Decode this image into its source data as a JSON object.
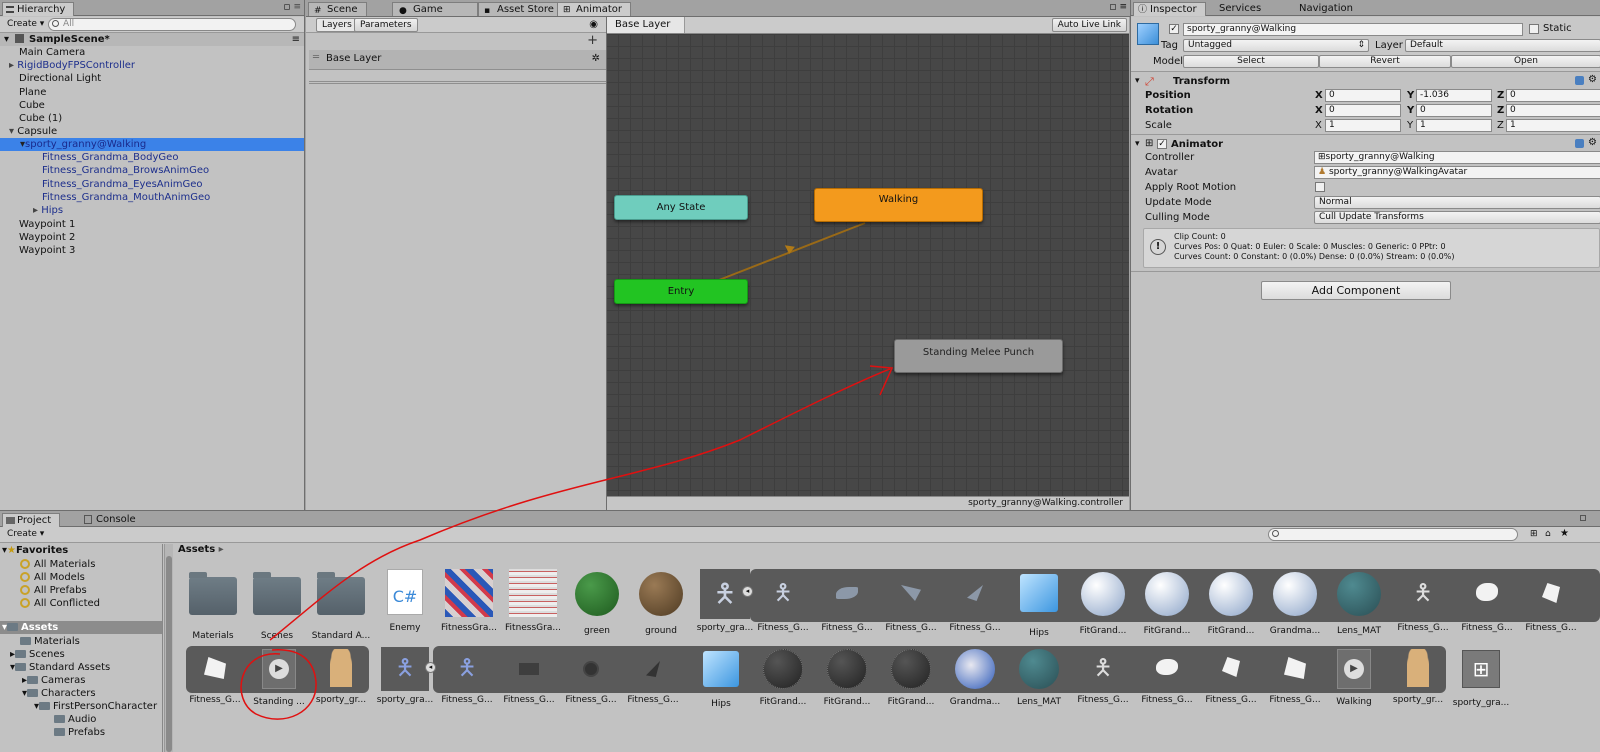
{
  "hierarchy": {
    "tab": "Hierarchy",
    "create": "Create",
    "search_placeholder": "All",
    "scene": "SampleScene*",
    "items": [
      {
        "label": "Main Camera"
      },
      {
        "label": "RigidBodyFPSController"
      },
      {
        "label": "Directional Light"
      },
      {
        "label": "Plane"
      },
      {
        "label": "Cube"
      },
      {
        "label": "Cube (1)"
      },
      {
        "label": "Capsule"
      },
      {
        "label": "sporty_granny@Walking"
      },
      {
        "label": "Fitness_Grandma_BodyGeo"
      },
      {
        "label": "Fitness_Grandma_BrowsAnimGeo"
      },
      {
        "label": "Fitness_Grandma_EyesAnimGeo"
      },
      {
        "label": "Fitness_Grandma_MouthAnimGeo"
      },
      {
        "label": "Hips"
      },
      {
        "label": "Waypoint 1"
      },
      {
        "label": "Waypoint 2"
      },
      {
        "label": "Waypoint 3"
      }
    ]
  },
  "center_tabs": {
    "scene": "Scene",
    "game": "Game",
    "asset_store": "Asset Store",
    "animator": "Animator"
  },
  "animator": {
    "layers_tab": "Layers",
    "parameters_tab": "Parameters",
    "layer_name": "Base Layer",
    "breadcrumb": "Base Layer",
    "auto_live_link": "Auto Live Link",
    "states": {
      "any_state": "Any State",
      "walking": "Walking",
      "entry": "Entry",
      "punch": "Standing Melee Punch"
    },
    "footer": "sporty_granny@Walking.controller"
  },
  "inspector": {
    "tabs": {
      "inspector": "Inspector",
      "services": "Services",
      "navigation": "Navigation"
    },
    "object_name": "sporty_granny@Walking",
    "static_label": "Static",
    "tag_label": "Tag",
    "tag_value": "Untagged",
    "layer_label": "Layer",
    "layer_value": "Default",
    "model_label": "Model",
    "select": "Select",
    "revert": "Revert",
    "open": "Open",
    "transform": {
      "title": "Transform",
      "position": "Position",
      "rotation": "Rotation",
      "scale": "Scale",
      "pos": {
        "x": "0",
        "y": "-1.036",
        "z": "0"
      },
      "rot": {
        "x": "0",
        "y": "0",
        "z": "0"
      },
      "scl": {
        "x": "1",
        "y": "1",
        "z": "1"
      }
    },
    "animator": {
      "title": "Animator",
      "controller_label": "Controller",
      "controller_value": "sporty_granny@Walking",
      "avatar_label": "Avatar",
      "avatar_value": "sporty_granny@WalkingAvatar",
      "root_motion_label": "Apply Root Motion",
      "update_mode_label": "Update Mode",
      "update_mode_value": "Normal",
      "culling_mode_label": "Culling Mode",
      "culling_mode_value": "Cull Update Transforms",
      "info_line1": "Clip Count: 0",
      "info_line2": "Curves Pos: 0 Quat: 0 Euler: 0 Scale: 0 Muscles: 0 Generic: 0 PPtr: 0",
      "info_line3": "Curves Count: 0 Constant: 0 (0.0%) Dense: 0 (0.0%) Stream: 0 (0.0%)"
    },
    "add_component": "Add Component"
  },
  "project": {
    "tab": "Project",
    "console_tab": "Console",
    "create": "Create",
    "favorites": "Favorites",
    "fav_items": [
      "All Materials",
      "All Models",
      "All Prefabs",
      "All Conflicted"
    ],
    "assets": "Assets",
    "tree": [
      {
        "label": "Materials"
      },
      {
        "label": "Scenes"
      },
      {
        "label": "Standard Assets"
      },
      {
        "label": "Cameras"
      },
      {
        "label": "Characters"
      },
      {
        "label": "FirstPersonCharacter"
      },
      {
        "label": "Audio"
      },
      {
        "label": "Prefabs"
      }
    ],
    "breadcrumb": "Assets",
    "row1": [
      "Materials",
      "Scenes",
      "Standard A...",
      "Enemy",
      "FitnessGra...",
      "FitnessGra...",
      "green",
      "ground",
      "sporty_gra...",
      "Fitness_G...",
      "Fitness_G...",
      "Fitness_G...",
      "Fitness_G...",
      "Hips",
      "FitGrand...",
      "FitGrand...",
      "FitGrand...",
      "Grandma...",
      "Lens_MAT",
      "Fitness_G...",
      "Fitness_G...",
      "Fitness_G..."
    ],
    "row2": [
      "Fitness_G...",
      "Standing ...",
      "sporty_gr...",
      "sporty_gra...",
      "Fitness_G...",
      "Fitness_G...",
      "Fitness_G...",
      "Fitness_G...",
      "Hips",
      "FitGrand...",
      "FitGrand...",
      "FitGrand...",
      "Grandma...",
      "Lens_MAT",
      "Fitness_G...",
      "Fitness_G...",
      "Fitness_G...",
      "Fitness_G...",
      "Walking",
      "sporty_gr...",
      "sporty_gra..."
    ]
  },
  "colors": {
    "any_state": "#6fcdbd",
    "walking": "#f39a1d",
    "entry": "#22c422",
    "punch": "#9a9a9a",
    "selection": "#3b82e8",
    "annotation": "#e01010"
  }
}
